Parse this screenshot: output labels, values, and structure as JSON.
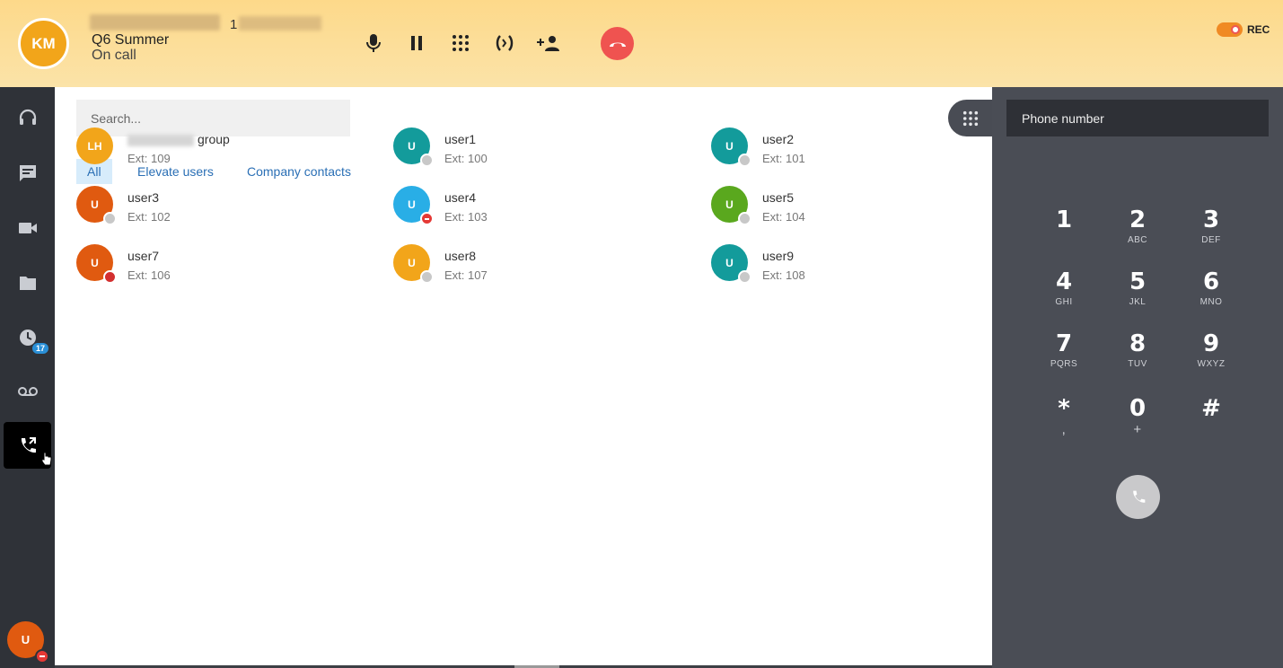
{
  "header": {
    "caller_initials": "KM",
    "caller_number_prefix": "1",
    "queue_name": "Q6 Summer",
    "status": "On call",
    "rec_label": "REC",
    "controls": [
      "microphone-icon",
      "pause-icon",
      "dialpad-icon",
      "transfer-icon",
      "add-participant-icon",
      "hangup-icon"
    ],
    "colors": {
      "accent": "#fdd98a",
      "hangup": "#ef5350",
      "rec_toggle": "#f08a24"
    }
  },
  "nav": {
    "items": [
      "headset-icon",
      "chat-icon",
      "video-icon",
      "folder-icon",
      "history-icon",
      "voicemail-icon",
      "phone-forward-icon"
    ],
    "history_badge": "17",
    "active": "phone-forward-icon",
    "me_initials": "U"
  },
  "search": {
    "placeholder": "Search..."
  },
  "filters": {
    "all": "All",
    "elevate": "Elevate users",
    "company": "Company contacts"
  },
  "contacts": [
    {
      "initials": "LH",
      "name": "group",
      "ext": "Ext: 109",
      "color": "#f2a51a",
      "status": "none"
    },
    {
      "initials": "U",
      "name": "user1",
      "ext": "Ext: 100",
      "color": "#139b9b",
      "status": "offline"
    },
    {
      "initials": "U",
      "name": "user2",
      "ext": "Ext: 101",
      "color": "#139b9b",
      "status": "offline"
    },
    {
      "initials": "U",
      "name": "user3",
      "ext": "Ext: 102",
      "color": "#e05a10",
      "status": "offline"
    },
    {
      "initials": "U",
      "name": "user4",
      "ext": "Ext: 103",
      "color": "#29aee6",
      "status": "dnd"
    },
    {
      "initials": "U",
      "name": "user5",
      "ext": "Ext: 104",
      "color": "#5aa81e",
      "status": "offline"
    },
    {
      "initials": "U",
      "name": "user7",
      "ext": "Ext: 106",
      "color": "#e05a10",
      "status": "busy"
    },
    {
      "initials": "U",
      "name": "user8",
      "ext": "Ext: 107",
      "color": "#f2a51a",
      "status": "offline"
    },
    {
      "initials": "U",
      "name": "user9",
      "ext": "Ext: 108",
      "color": "#139b9b",
      "status": "offline"
    }
  ],
  "dialpad": {
    "placeholder": "Phone number",
    "keys": [
      {
        "d": "1",
        "l": ""
      },
      {
        "d": "2",
        "l": "ABC"
      },
      {
        "d": "3",
        "l": "DEF"
      },
      {
        "d": "4",
        "l": "GHI"
      },
      {
        "d": "5",
        "l": "JKL"
      },
      {
        "d": "6",
        "l": "MNO"
      },
      {
        "d": "7",
        "l": "PQRS"
      },
      {
        "d": "8",
        "l": "TUV"
      },
      {
        "d": "9",
        "l": "WXYZ"
      },
      {
        "d": "*",
        "l": ","
      },
      {
        "d": "0",
        "l": "+"
      },
      {
        "d": "#",
        "l": ""
      }
    ]
  }
}
